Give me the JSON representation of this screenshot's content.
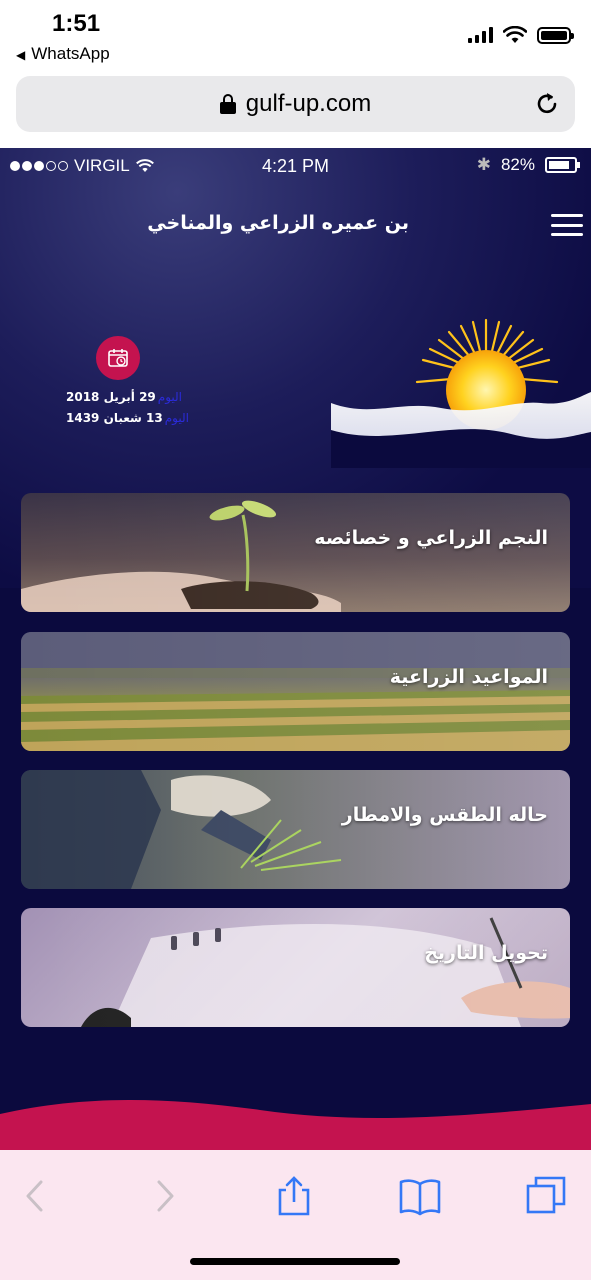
{
  "outer_status": {
    "time": "1:51",
    "back_app": "WhatsApp"
  },
  "browser": {
    "url": "gulf-up.com"
  },
  "inner_status": {
    "carrier": "VIRGIL",
    "time": "4:21 PM",
    "battery": "82%"
  },
  "header": {
    "title": "بن عميره الزراعي والمناخي"
  },
  "dates": {
    "gregorian_label": "اليوم",
    "gregorian_value": "29 أبريل 2018",
    "hijri_label": "اليوم",
    "hijri_value": "13 شعبان 1439"
  },
  "cards": [
    {
      "label": "النجم الزراعي و خصائصه"
    },
    {
      "label": "المواعيد الزراعية"
    },
    {
      "label": "حاله الطقس  والامطار"
    },
    {
      "label": "تحويل التاريخ"
    }
  ],
  "colors": {
    "app_background": "#0b0a3e",
    "accent": "#c4134f",
    "toolbar_tint": "#3478f6"
  },
  "icons": {
    "menu": "hamburger-menu-icon",
    "calendar": "calendar-clock-icon",
    "share": "share-icon",
    "bookmarks": "book-icon",
    "tabs": "tabs-icon",
    "back": "chevron-left-icon",
    "forward": "chevron-right-icon",
    "reload": "reload-icon",
    "lock": "lock-icon"
  }
}
